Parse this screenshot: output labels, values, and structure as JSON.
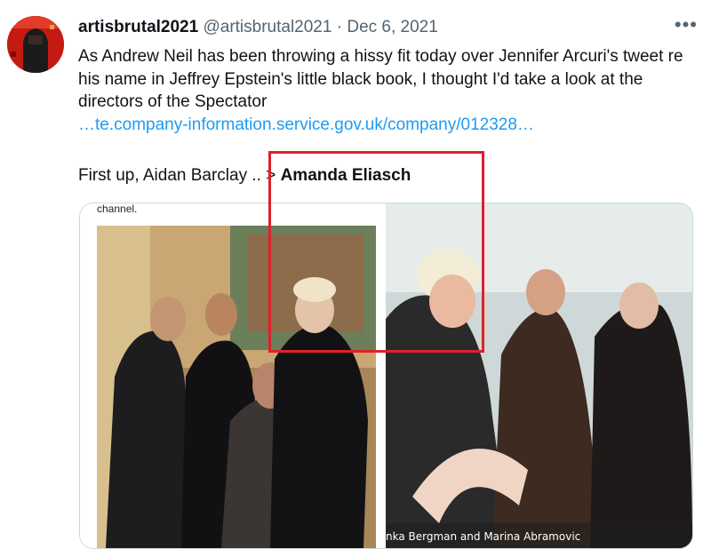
{
  "tweet": {
    "display_name": "artisbrutal2021",
    "handle": "@artisbrutal2021",
    "separator": "·",
    "date": "Dec 6, 2021",
    "more_label": "•••",
    "text": "As Andrew Neil has been throwing a hissy fit today over Jennifer Arcuri's tweet re his name in Jeffrey Epstein's little black book, I thought I'd take a look at the directors of the Spectator",
    "link_text": "…te.company-information.service.gov.uk/company/012328…",
    "line2_prefix": "First up, Aidan Barclay .. > ",
    "line2_bold": "Amanda Eliasch"
  },
  "media": {
    "left_caption": "channel.",
    "right_caption": "nka Bergman and Marina Abramovic"
  },
  "colors": {
    "link": "#1d9bf0",
    "muted": "#536471",
    "highlight_box": "#e0202a"
  }
}
